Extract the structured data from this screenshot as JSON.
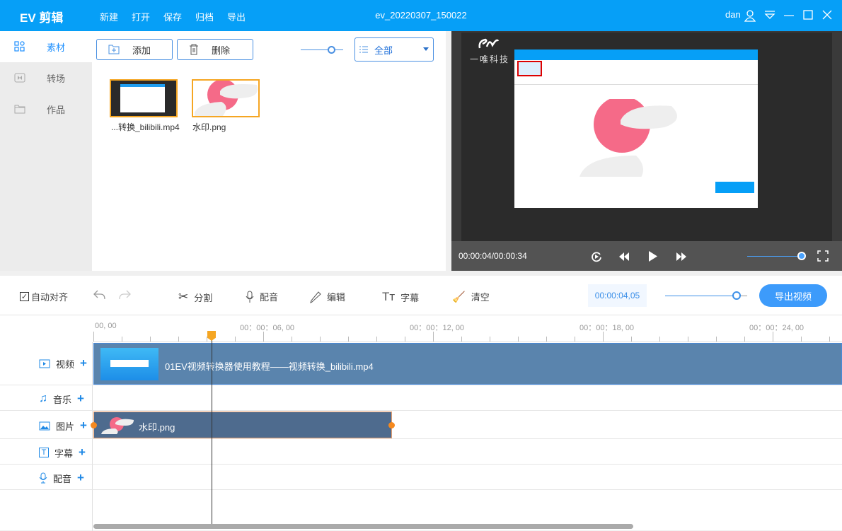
{
  "app": {
    "title": "EV 剪辑",
    "document": "ev_20220307_150022",
    "user": "dan",
    "menu": [
      "新建",
      "打开",
      "保存",
      "归档",
      "导出"
    ]
  },
  "sidebar": {
    "items": [
      {
        "label": "素材",
        "icon": "grid-icon",
        "active": true
      },
      {
        "label": "转场",
        "icon": "transition-icon"
      },
      {
        "label": "作品",
        "icon": "folder-icon"
      }
    ]
  },
  "media": {
    "add_label": "添加",
    "delete_label": "删除",
    "filter": "全部",
    "files": [
      {
        "name": "...转换_bilibili.mp4"
      },
      {
        "name": "水印.png"
      }
    ]
  },
  "preview": {
    "logo_text": "一唯科技",
    "time": "00:00:04/00:00:34",
    "volume": 1.0
  },
  "toolbar": {
    "auto_align": "自动对齐",
    "auto_align_checked": true,
    "split": "分割",
    "dub": "配音",
    "edit": "编辑",
    "subtitle": "字幕",
    "clear": "清空",
    "timecode": "00:00:04,05",
    "zoom": 0.8,
    "export": "导出视频"
  },
  "timeline": {
    "ruler": [
      "00, 00",
      "00：00：06, 00",
      "00：00：12, 00",
      "00：00：18, 00",
      "00：00：24, 00"
    ],
    "playhead_seconds": 4.05,
    "tracks": [
      {
        "label": "视频"
      },
      {
        "label": "音乐"
      },
      {
        "label": "图片"
      },
      {
        "label": "字幕"
      },
      {
        "label": "配音"
      }
    ],
    "video_clip": "01EV视频转换器使用教程——视频转换_bilibili.mp4",
    "image_clip": "水印.png"
  },
  "colors": {
    "brand": "#069ff7",
    "clip_video": "#5a84ad",
    "clip_image": "#4e6b8e",
    "playhead": "#f5a623"
  }
}
